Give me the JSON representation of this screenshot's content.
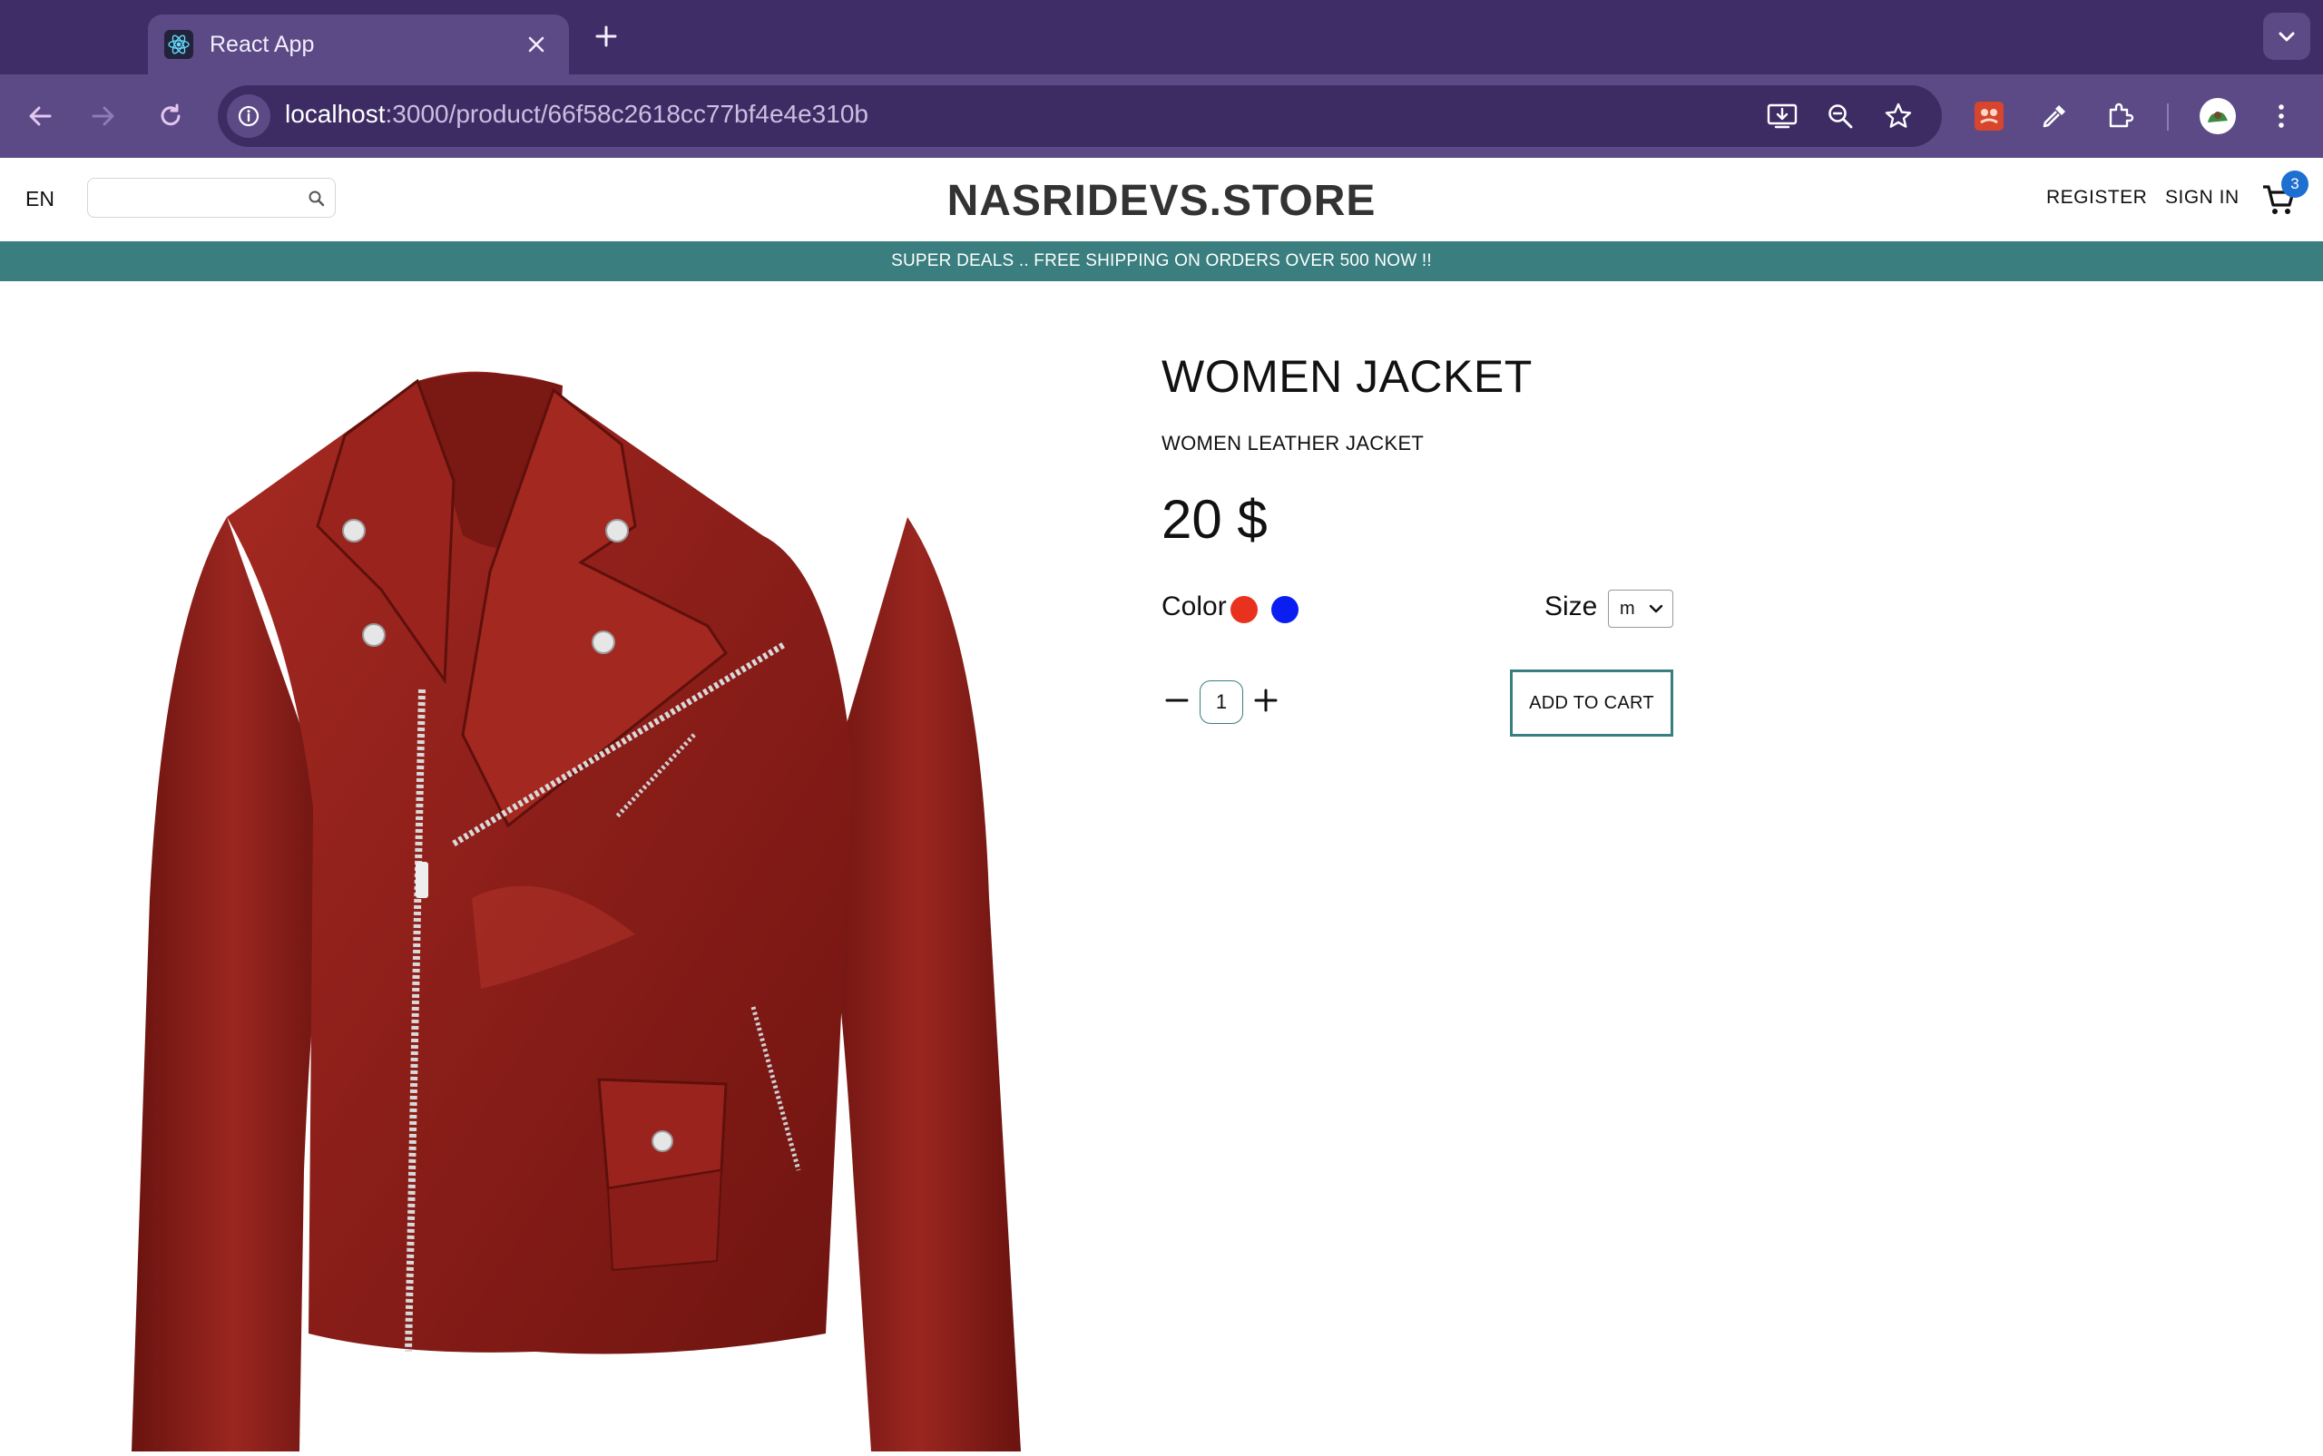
{
  "browser": {
    "tab_title": "React App",
    "url_host": "localhost",
    "url_path": ":3000/product/66f58c2618cc77bf4e4e310b"
  },
  "header": {
    "language": "EN",
    "search_placeholder": "",
    "logo": "NASRIDEVS.STORE",
    "register": "REGISTER",
    "sign_in": "SIGN IN",
    "cart_count": "3"
  },
  "banner": {
    "text": "SUPER DEALS .. FREE SHIPPING ON ORDERS OVER 500 NOW !!"
  },
  "product": {
    "title": "WOMEN JACKET",
    "description": "WOMEN LEATHER JACKET",
    "price": "20 $",
    "color_label": "Color",
    "colors": [
      "#e8321e",
      "#0a1ef2"
    ],
    "size_label": "Size",
    "size_value": "m",
    "quantity": "1",
    "add_to_cart": "ADD TO CART"
  },
  "colors": {
    "tab_strip": "#3f2d68",
    "toolbar": "#5b4a86",
    "accent_teal": "#3a7e7f",
    "jacket_red": "#8e1f1a"
  }
}
